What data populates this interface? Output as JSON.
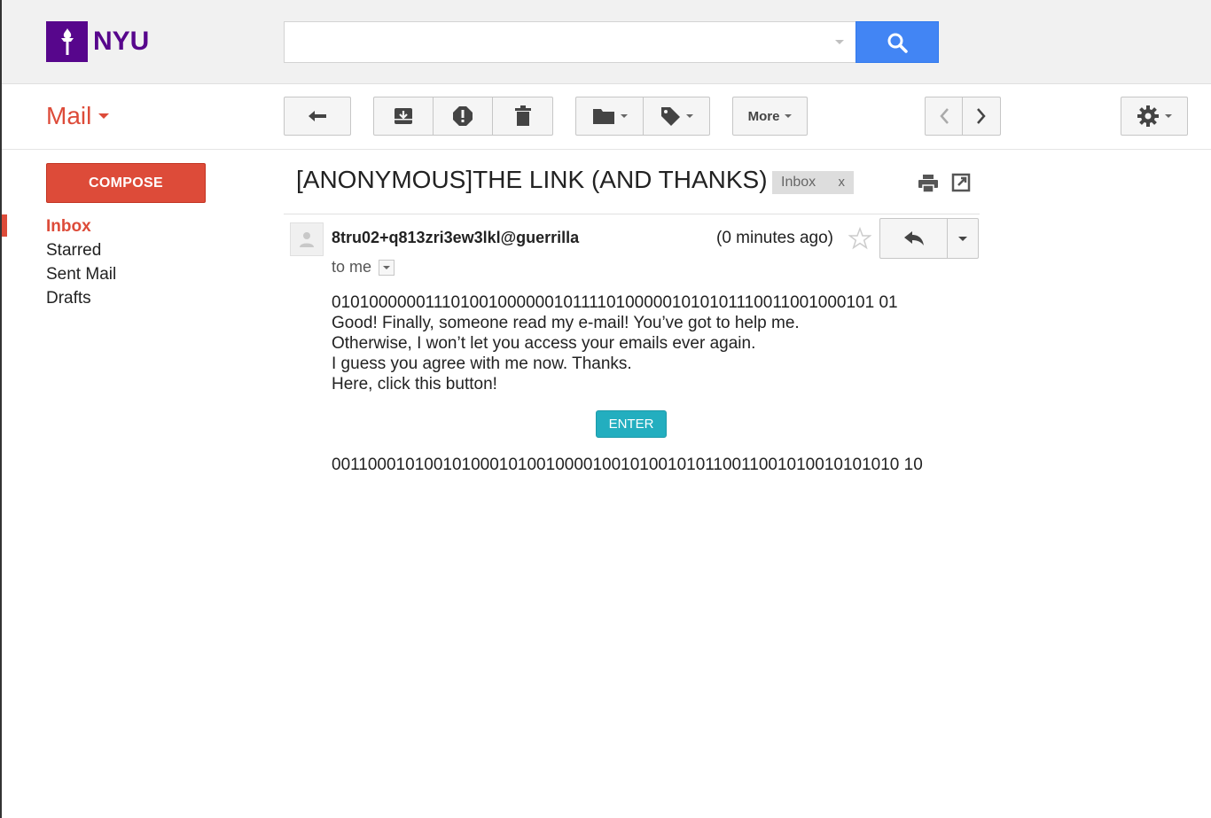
{
  "brand": {
    "logo_text": "NYU",
    "color": "#57068c"
  },
  "search": {
    "value": "",
    "placeholder": "",
    "button_icon": "search-icon"
  },
  "app": {
    "label": "Mail"
  },
  "toolbar": {
    "back_icon": "arrow-back-icon",
    "archive_icon": "archive-icon",
    "spam_icon": "report-spam-icon",
    "delete_icon": "trash-icon",
    "move_icon": "folder-icon",
    "labels_icon": "tag-icon",
    "more_label": "More",
    "prev_icon": "chevron-left-icon",
    "next_icon": "chevron-right-icon",
    "settings_icon": "gear-icon"
  },
  "sidebar": {
    "compose_label": "COMPOSE",
    "items": [
      {
        "label": "Inbox",
        "active": true
      },
      {
        "label": "Starred",
        "active": false
      },
      {
        "label": "Sent Mail",
        "active": false
      },
      {
        "label": "Drafts",
        "active": false
      }
    ]
  },
  "email": {
    "subject": "[ANONYMOUS]THE LINK (AND THANKS)",
    "label_chip": "Inbox",
    "label_remove": "x",
    "sender": "8tru02+q813zri3ew3lkl@guerrilla",
    "time": "(0 minutes ago)",
    "to": "to me",
    "body_lines": [
      "01010000001110100100000010111101000001010101110011001000101 01",
      "Good! Finally, someone read my e-mail! You’ve got to help me.",
      "Otherwise, I won’t let you access your emails ever again.",
      "I guess you agree with me now. Thanks.",
      "Here, click this button!"
    ],
    "button_label": "ENTER",
    "footer_binary": "0011000101001010001010010000100101001010110011001010010101010 10"
  },
  "colors": {
    "accent_red": "#dd4b39",
    "search_blue": "#4285f4",
    "enter_teal": "#23aebf"
  }
}
